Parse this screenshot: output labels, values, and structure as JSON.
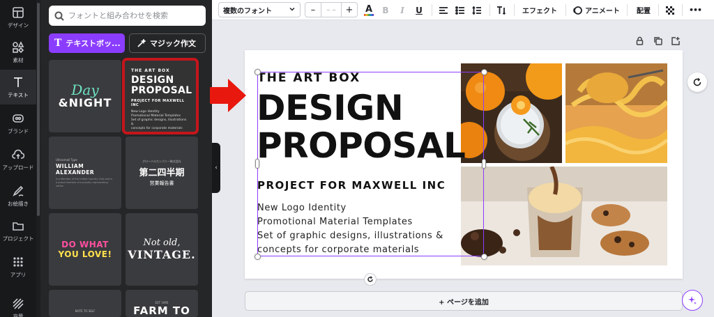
{
  "rail": {
    "items": [
      {
        "label": "デザイン",
        "icon": "layout-icon"
      },
      {
        "label": "素材",
        "icon": "shapes-icon"
      },
      {
        "label": "テキスト",
        "icon": "text-icon"
      },
      {
        "label": "ブランド",
        "icon": "brand-icon"
      },
      {
        "label": "アップロード",
        "icon": "upload-cloud-icon"
      },
      {
        "label": "お絵描き",
        "icon": "draw-icon"
      },
      {
        "label": "プロジェクト",
        "icon": "folder-icon"
      },
      {
        "label": "アプリ",
        "icon": "apps-grid-icon"
      },
      {
        "label": "背景",
        "icon": "background-icon"
      }
    ]
  },
  "panel": {
    "search_placeholder": "フォントと組み合わせを検索",
    "text_box_button": "テキストボッ...",
    "magic_write_button": "マジック作文",
    "templates": {
      "t1": {
        "line1": "Day",
        "line2": "&NIGHT"
      },
      "t2": {
        "line1": "THE ART BOX",
        "line2": "DESIGN",
        "line3": "PROPOSAL",
        "line4": "PROJECT FOR MAXWELL INC",
        "line5": "New Logo Identity",
        "line6": "Promotional Material Templates",
        "line7": "Set of graphic designs, illustrations &",
        "line8": "concepts for corporate materials"
      },
      "t3": {
        "line1": "Ultrasmall Type",
        "line2": "WILLIAM ALEXANDER",
        "line3": "is a Member of the United Country Club and is a proud member of a proudly representing nation"
      },
      "t4": {
        "line1": "グローバルカンパニー株式会社",
        "line2": "第二四半期",
        "line3": "営業報告書"
      },
      "t5": {
        "line1": "DO WHAT",
        "line2": "YOU LOVE!"
      },
      "t6": {
        "line1": "Not old,",
        "line2": "VINTAGE."
      },
      "t7": {
        "line1": "NOTE TO SELF"
      },
      "t8": {
        "line1": "EST 1995",
        "line2": "FARM TO"
      }
    }
  },
  "toolbar": {
    "font": "複数のフォント",
    "size_placeholder": "– –",
    "minus": "–",
    "plus": "+",
    "effects": "エフェクト",
    "animate": "アニメート",
    "position": "配置",
    "bold": "B",
    "italic": "I",
    "underline": "U",
    "text_color": "A",
    "more": "•••"
  },
  "design": {
    "title_small": "THE ART BOX",
    "title_big_1": "DESIGN",
    "title_big_2": "PROPOSAL",
    "project": "PROJECT FOR MAXWELL INC",
    "lines": [
      "New Logo Identity",
      "Promotional Material Templates",
      "Set of graphic designs, illustrations &",
      "concepts for corporate materials"
    ]
  },
  "canvas": {
    "add_page": "+ ページを追加"
  },
  "colors": {
    "accent_purple": "#8b3dff",
    "highlight_red": "#c4161c",
    "rail_bg": "#18191b",
    "panel_bg": "#252627"
  }
}
